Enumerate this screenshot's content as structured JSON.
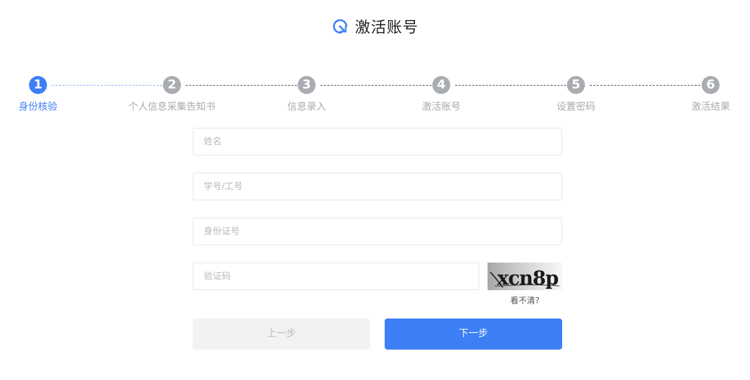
{
  "header": {
    "title": "激活账号",
    "logo_icon": "refresh-magnifier-icon",
    "accent_color": "#3d7ff5"
  },
  "stepper": {
    "current_step": 1,
    "steps": [
      {
        "number": "1",
        "label": "身份核验",
        "active": true
      },
      {
        "number": "2",
        "label": "个人信息采集告知书",
        "active": false
      },
      {
        "number": "3",
        "label": "信息录入",
        "active": false
      },
      {
        "number": "4",
        "label": "激活账号",
        "active": false
      },
      {
        "number": "5",
        "label": "设置密码",
        "active": false
      },
      {
        "number": "6",
        "label": "激活结果",
        "active": false
      }
    ]
  },
  "form": {
    "name_placeholder": "姓名",
    "id_number_placeholder": "学号/工号",
    "identity_card_placeholder": "身份证号",
    "captcha_placeholder": "验证码",
    "captcha_text": "xcn8p",
    "captcha_refresh_label": "看不清?"
  },
  "actions": {
    "prev_label": "上一步",
    "next_label": "下一步"
  }
}
